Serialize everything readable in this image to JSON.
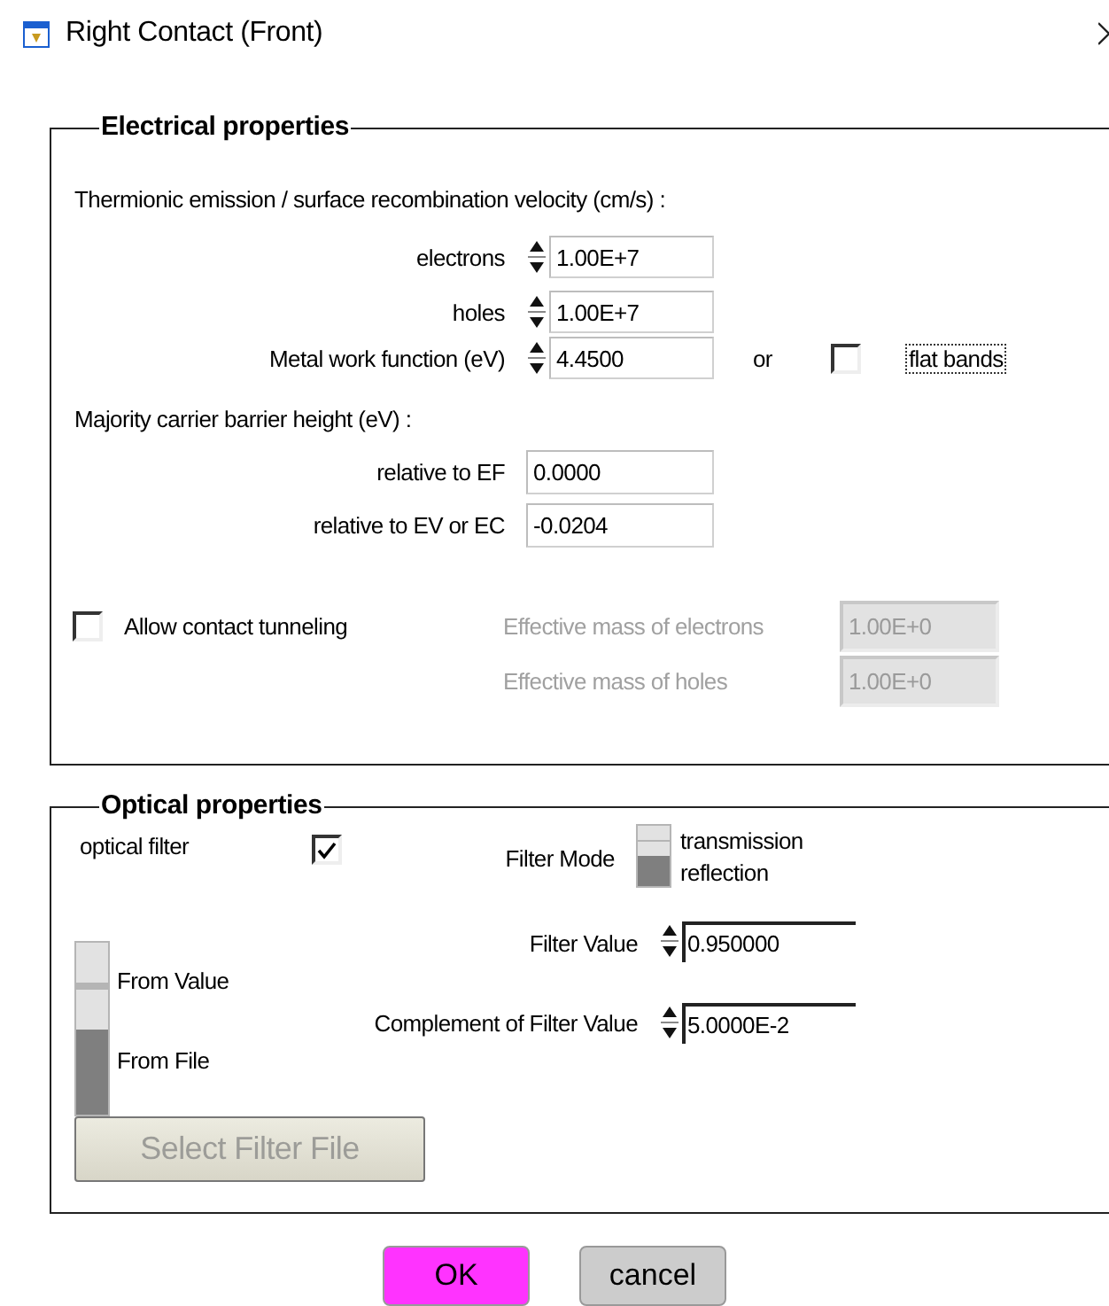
{
  "window": {
    "title": "Right Contact (Front)"
  },
  "electrical": {
    "legend": "Electrical properties",
    "velocity_heading": "Thermionic emission / surface recombination velocity (cm/s) :",
    "velocity_fields": [
      {
        "label": "electrons",
        "value": "1.00E+7"
      },
      {
        "label": "holes",
        "value": "1.00E+7"
      }
    ],
    "work_function": {
      "label": "Metal work function (eV)",
      "value": "4.4500",
      "or": "or",
      "flat_bands": {
        "label": "flat bands",
        "checked": false
      }
    },
    "barrier_heading": "Majority carrier barrier height (eV) :",
    "barrier_fields": [
      {
        "label": "relative to EF",
        "value": "0.0000"
      },
      {
        "label": "relative to EV or EC",
        "value": "-0.0204"
      }
    ],
    "tunneling": {
      "label": "Allow contact tunneling",
      "checked": false
    },
    "mass_fields": [
      {
        "label": "Effective mass of electrons",
        "value": "1.00E+0",
        "disabled": true
      },
      {
        "label": "Effective mass of holes",
        "value": "1.00E+0",
        "disabled": true
      }
    ]
  },
  "optical": {
    "legend": "Optical properties",
    "optical_filter": {
      "label": "optical filter",
      "checked": true
    },
    "filter_mode": {
      "label": "Filter Mode",
      "options": [
        {
          "label": "transmission",
          "selected": true
        },
        {
          "label": "reflection",
          "selected": false
        }
      ]
    },
    "source": {
      "options": [
        {
          "label": "From Value",
          "selected": true
        },
        {
          "label": "From File",
          "selected": false
        }
      ]
    },
    "value_fields": [
      {
        "label": "Filter Value",
        "value": "0.950000"
      },
      {
        "label": "Complement of Filter Value",
        "value": "5.0000E-2"
      }
    ],
    "select_button": {
      "label": "Select Filter File",
      "disabled": true
    }
  },
  "buttons": [
    {
      "label": "OK",
      "kind": "primary"
    },
    {
      "label": "cancel",
      "kind": "secondary"
    }
  ]
}
